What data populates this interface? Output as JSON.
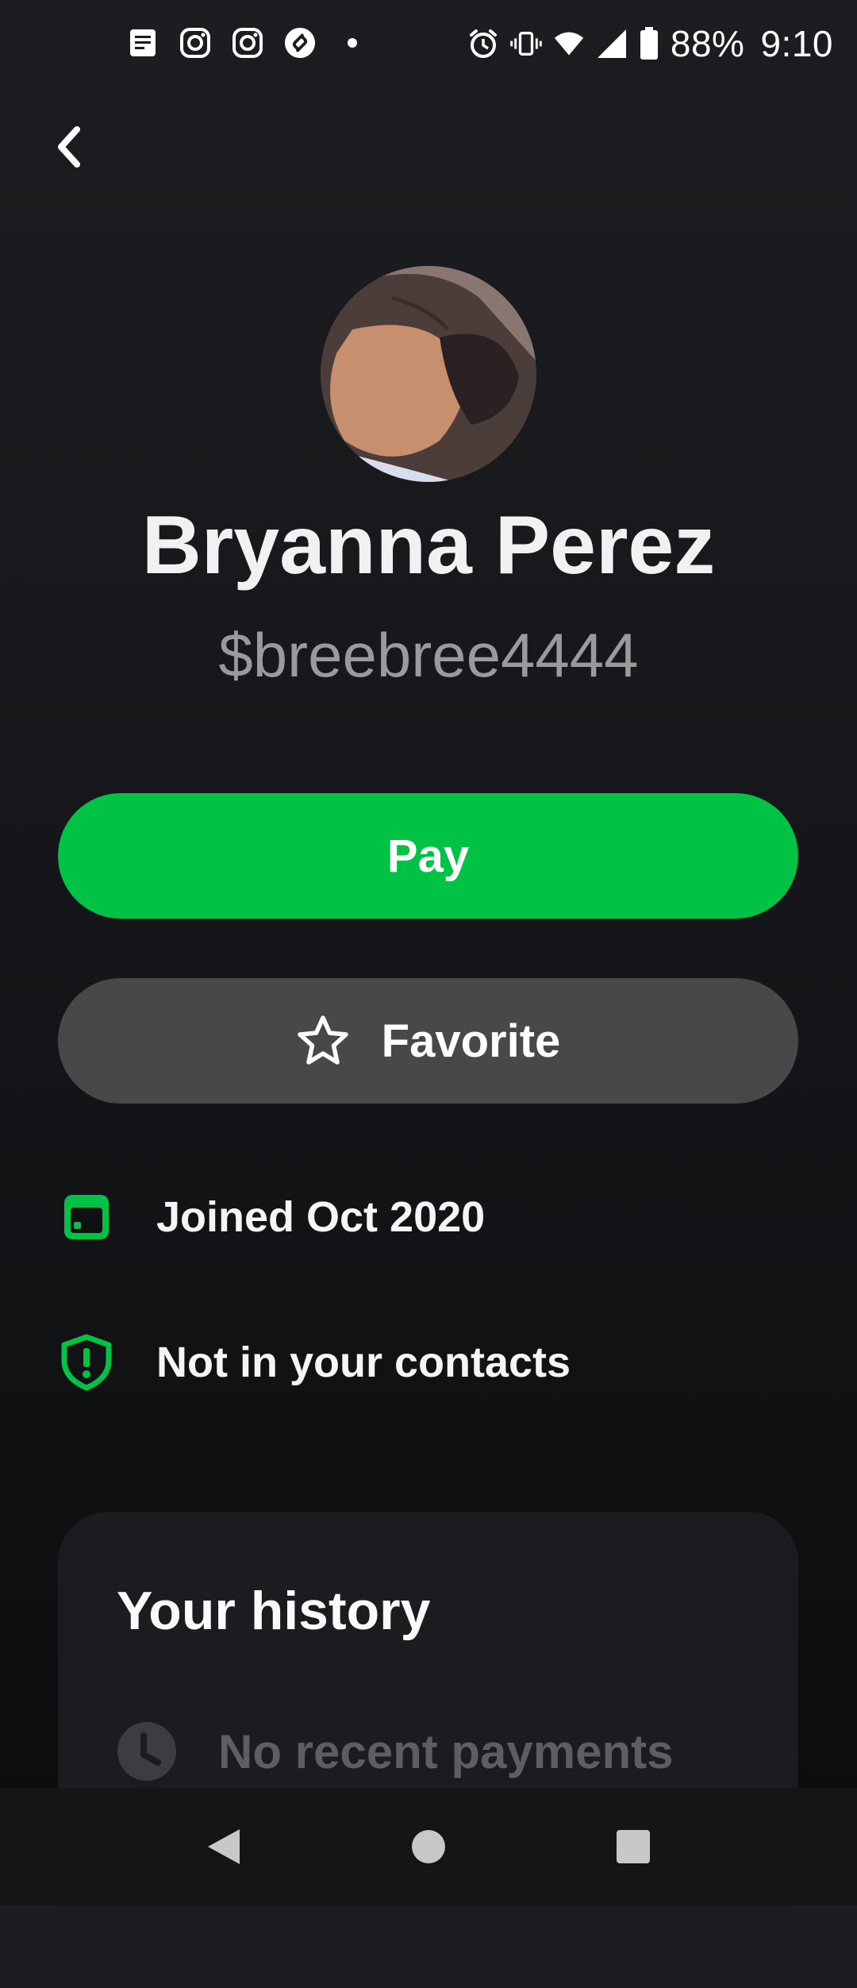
{
  "status_bar": {
    "left_icons": [
      "notes-icon",
      "instagram-icon",
      "instagram-icon",
      "shazam-icon",
      "dot-icon"
    ],
    "right_icons": [
      "alarm-icon",
      "vibrate-icon",
      "wifi-icon",
      "signal-icon",
      "battery-icon"
    ],
    "battery": "88%",
    "time": "9:10"
  },
  "profile": {
    "name": "Bryanna Perez",
    "cashtag": "$breebree4444"
  },
  "actions": {
    "pay_label": "Pay",
    "favorite_label": "Favorite"
  },
  "info": {
    "joined": "Joined Oct 2020",
    "contacts": "Not in your contacts"
  },
  "history": {
    "title": "Your history",
    "empty_text": "No recent payments"
  },
  "colors": {
    "accent_green": "#00c244",
    "secondary_button": "#48484b",
    "background": "#141518"
  }
}
